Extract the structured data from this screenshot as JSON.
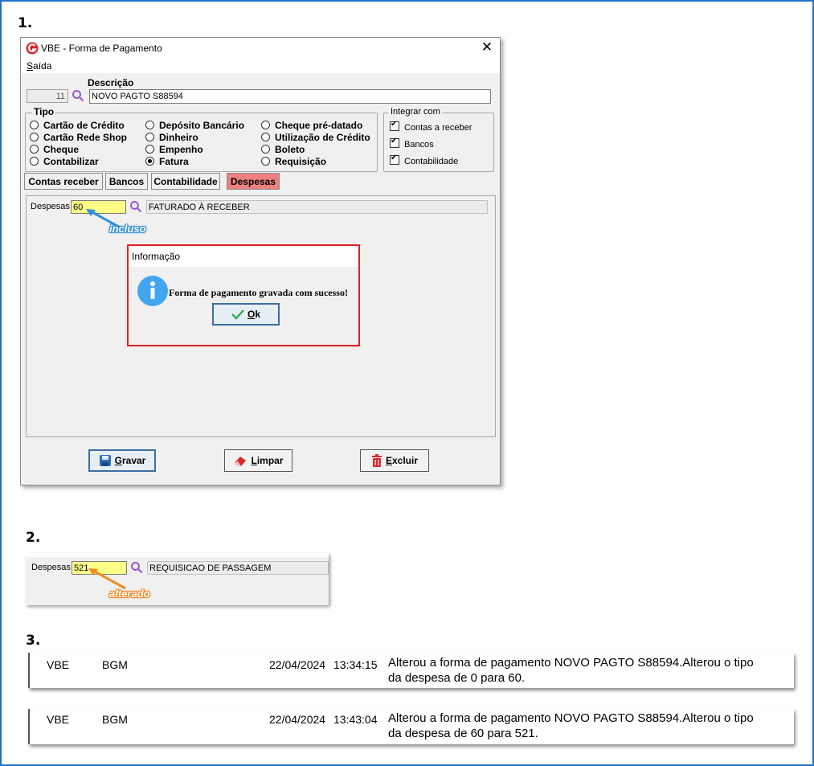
{
  "steps": {
    "s1": "1.",
    "s2": "2.",
    "s3": "3."
  },
  "window": {
    "title": "VBE - Forma de Pagamento",
    "menu": {
      "saida_first": "S",
      "saida_rest": "aída"
    },
    "code_value": "11",
    "descricao_label": "Descrição",
    "descricao_value": "NOVO PAGTO S88594",
    "tipo_title": "Tipo",
    "tipo_options": {
      "cartao_credito": "Cartão de Crédito",
      "cartao_rede_shop": "Cartão Rede Shop",
      "cheque": "Cheque",
      "contabilizar": "Contabilizar",
      "deposito_bancario": "Depósito Bancário",
      "dinheiro": "Dinheiro",
      "empenho": "Empenho",
      "fatura": "Fatura",
      "cheque_pre_datado": "Cheque pré-datado",
      "utilizacao_credito": "Utilização de Crédito",
      "boleto": "Boleto",
      "requisicao": "Requisição"
    },
    "tipo_selected": "fatura",
    "integrar_title": "Integrar com",
    "integrar": {
      "contas_receber": "Contas a receber",
      "bancos": "Bancos",
      "contabilidade": "Contabilidade"
    },
    "tabs": {
      "contas_receber": "Contas receber",
      "bancos": "Bancos",
      "contabilidade": "Contabilidade",
      "despesas": "Despesas"
    },
    "despesas_label": "Despesas",
    "despesas_code": "60",
    "despesas_desc": "FATURADO À RECEBER",
    "callout1": "incluso",
    "buttons": {
      "gravar_first": "G",
      "gravar_rest": "ravar",
      "limpar_first": "L",
      "limpar_rest": "impar",
      "excluir_first": "E",
      "excluir_rest": "xcluir"
    }
  },
  "dialog": {
    "title": "Informação",
    "message": "Forma de pagamento gravada com sucesso!",
    "ok_first": "O",
    "ok_rest": "k"
  },
  "snippet2": {
    "label": "Despesas",
    "code": "521",
    "desc": "REQUISICAO DE PASSAGEM",
    "callout": "alterado"
  },
  "log": [
    {
      "sys": "VBE",
      "user": "BGM",
      "date": "22/04/2024",
      "time": "13:34:15",
      "line1": "Alterou a forma de pagamento NOVO PAGTO S88594.Alterou o tipo",
      "line2": "da despesa de 0 para 60."
    },
    {
      "sys": "VBE",
      "user": "BGM",
      "date": "22/04/2024",
      "time": "13:43:04",
      "line1": "Alterou a forma de pagamento NOVO PAGTO S88594.Alterou o tipo",
      "line2": "da despesa de 60 para 521."
    }
  ],
  "colors": {
    "frame": "#1e73c8",
    "active_tab": "#ee8080",
    "highlight_field": "#ffff88",
    "dialog_border": "#e02020",
    "callout_blue": "#2f8fd8",
    "callout_orange": "#f08a24"
  }
}
